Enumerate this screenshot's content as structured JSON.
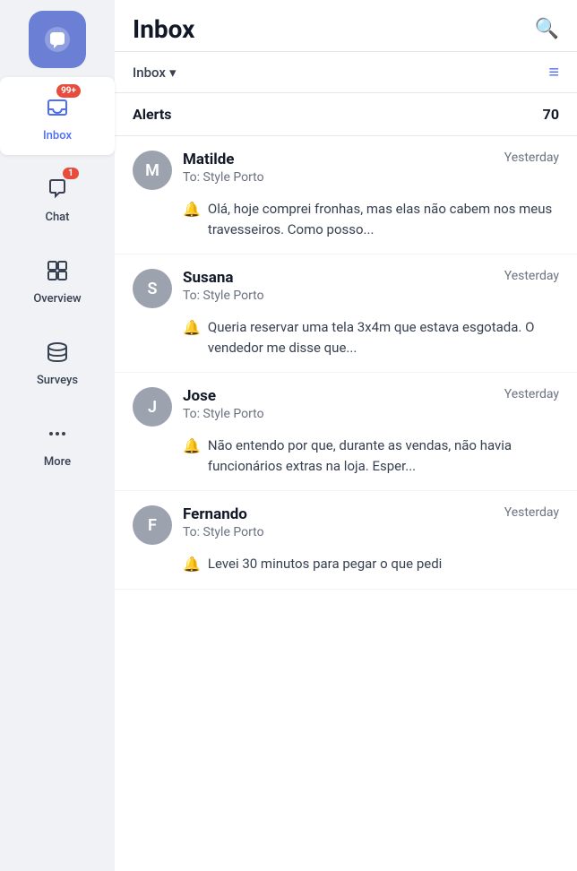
{
  "app": {
    "logo_label": "Chatwoot logo"
  },
  "sidebar": {
    "items": [
      {
        "id": "inbox",
        "label": "Inbox",
        "badge": "99+",
        "active": true
      },
      {
        "id": "chat",
        "label": "Chat",
        "badge": "1",
        "active": false
      },
      {
        "id": "overview",
        "label": "Overview",
        "badge": null,
        "active": false
      },
      {
        "id": "surveys",
        "label": "Surveys",
        "badge": null,
        "active": false
      },
      {
        "id": "more",
        "label": "More",
        "badge": null,
        "active": false
      }
    ]
  },
  "header": {
    "title": "Inbox",
    "search_label": "Search"
  },
  "subheader": {
    "dropdown_label": "Inbox",
    "filter_label": "Filter"
  },
  "alerts": {
    "label": "Alerts",
    "count": "70"
  },
  "messages": [
    {
      "id": 1,
      "sender": "Matilde",
      "avatar_letter": "M",
      "to": "To: Style Porto",
      "time": "Yesterday",
      "preview": "Olá, hoje comprei fronhas, mas elas não cabem nos meus travesseiros. Como posso..."
    },
    {
      "id": 2,
      "sender": "Susana",
      "avatar_letter": "S",
      "to": "To: Style Porto",
      "time": "Yesterday",
      "preview": "Queria reservar uma tela 3x4m que estava esgotada. O vendedor me disse que..."
    },
    {
      "id": 3,
      "sender": "Jose",
      "avatar_letter": "J",
      "to": "To: Style Porto",
      "time": "Yesterday",
      "preview": "Não entendo por que, durante as vendas, não havia funcionários extras na loja. Esper..."
    },
    {
      "id": 4,
      "sender": "Fernando",
      "avatar_letter": "F",
      "to": "To: Style Porto",
      "time": "Yesterday",
      "preview": "Levei 30 minutos para pegar o que pedi"
    }
  ]
}
